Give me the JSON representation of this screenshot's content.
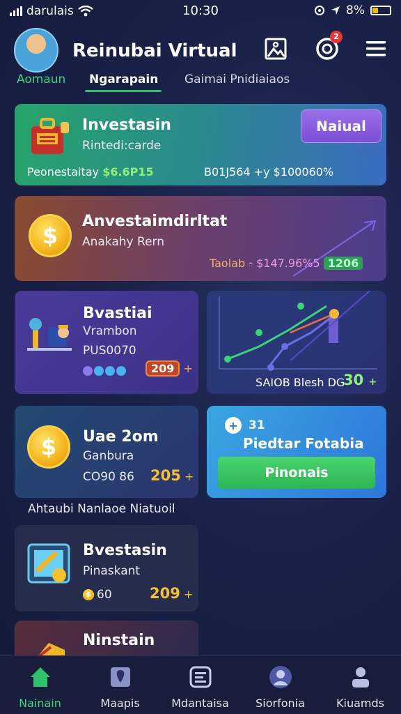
{
  "status_bar": {
    "carrier": "darulais",
    "time": "10:30",
    "battery": "8%"
  },
  "header": {
    "title": "Reinubai Virtual",
    "notification_count": "2"
  },
  "tabs": [
    {
      "label": "Aomaun"
    },
    {
      "label": "Ngarapain"
    },
    {
      "label": "Gaimai Pnidiaiaos"
    }
  ],
  "cards": {
    "c1": {
      "title": "Investasin",
      "subtitle": "Rintedi:carde",
      "footer_left": "Peonestaitay",
      "footer_value": "$6.6P15",
      "footer_right": "B01J564 +y  $100060%",
      "button": "Naiual"
    },
    "c2": {
      "title": "Anvestaimdirltat",
      "subtitle": "Anakahy Rern",
      "footer_label": "Taolab",
      "footer_value": "$147.96%5",
      "badge": "1206"
    },
    "c3": {
      "title": "Bvastiai",
      "line1": "Vrambon",
      "line2": "PUS0070",
      "badge": "209"
    },
    "c4": {
      "label": "SAIOB Blesh DG",
      "value": "30"
    },
    "c5": {
      "title": "Uae 2om",
      "subtitle": "Ganbura",
      "footer_left": "CO90 86",
      "value": "205"
    },
    "c6": {
      "count": "31",
      "title": "Piedtar Fotabia",
      "button": "Pinonais"
    },
    "section_label": "Ahtaubi Nanlaoe Niatuoil",
    "c7": {
      "title": "Bvestasin",
      "subtitle": "Pinaskant",
      "footer_left": "60",
      "value": "209"
    },
    "c8": {
      "title": "Ninstain"
    }
  },
  "bottom_nav": [
    {
      "label": "Nainain",
      "icon": "home-icon"
    },
    {
      "label": "Maapis",
      "icon": "map-icon"
    },
    {
      "label": "Mdantaisa",
      "icon": "chat-icon"
    },
    {
      "label": "Siorfonia",
      "icon": "profile-icon"
    },
    {
      "label": "Kiuamds",
      "icon": "user-icon"
    }
  ],
  "colors": {
    "accent_green": "#2fc26b",
    "accent_purple": "#7b4fd6",
    "gold": "#f5c12e"
  }
}
